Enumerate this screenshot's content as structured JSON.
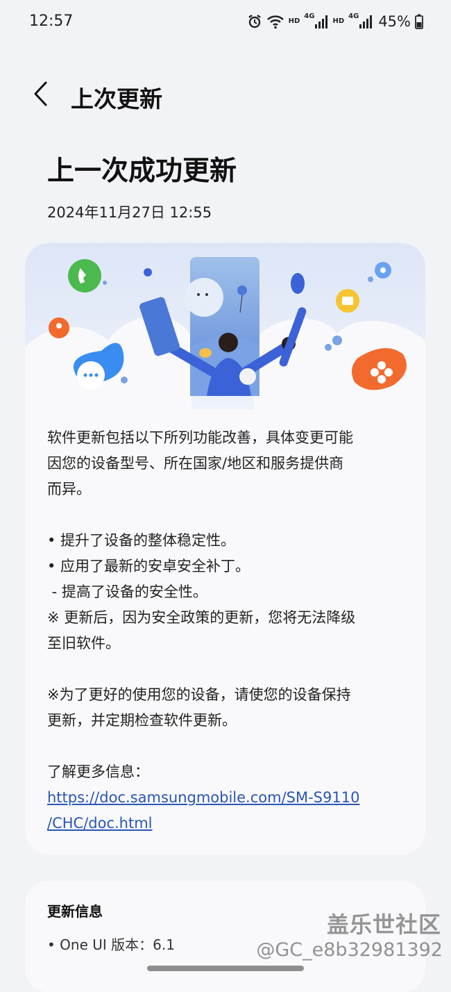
{
  "status_bar": {
    "time": "12:57",
    "hd_1": "HD",
    "net_1": "4G",
    "hd_2": "HD",
    "net_2": "4G",
    "battery_percent": "45%",
    "icons": [
      "alarm-icon",
      "wifi-icon",
      "signal-icon",
      "signal-icon",
      "battery-icon"
    ]
  },
  "header": {
    "back_icon": "chevron-left-icon",
    "title": "上次更新"
  },
  "main": {
    "page_title": "上一次成功更新",
    "date": "2024年11月27日 12:55"
  },
  "release_notes": {
    "intro_lines": [
      "软件更新包括以下所列功能改善，具体变更可能",
      "因您的设备型号、所在国家/地区和服务提供商",
      "而异。"
    ],
    "bullet_1": "• 提升了设备的整体稳定性。",
    "bullet_2": "• 应用了最新的安卓安全补丁。",
    "sub_bullet": " - 提高了设备的安全性。",
    "note_lines": [
      "※ 更新后，因为安全政策的更新，您将无法降级",
      "至旧软件。"
    ],
    "tip_lines": [
      "※为了更好的使用您的设备，请使您的设备保持",
      "更新，并定期检查软件更新。"
    ],
    "more_info_label": "了解更多信息：",
    "link_lines": [
      "https://doc.samsungmobile.com/SM-S9110",
      "/CHC/doc.html"
    ]
  },
  "update_info": {
    "title": "更新信息",
    "item": "• One UI 版本：6.1"
  },
  "watermark": {
    "site": "盖乐世社区",
    "user": "@GC_e8b32981392"
  },
  "colors": {
    "background": "#f2f3f6",
    "card": "#f9f9fc",
    "link": "#2a55b5",
    "accent_blue": "#3b62d6",
    "accent_orange": "#f26a2e",
    "accent_green": "#4cb94f",
    "accent_yellow": "#f7c431"
  }
}
